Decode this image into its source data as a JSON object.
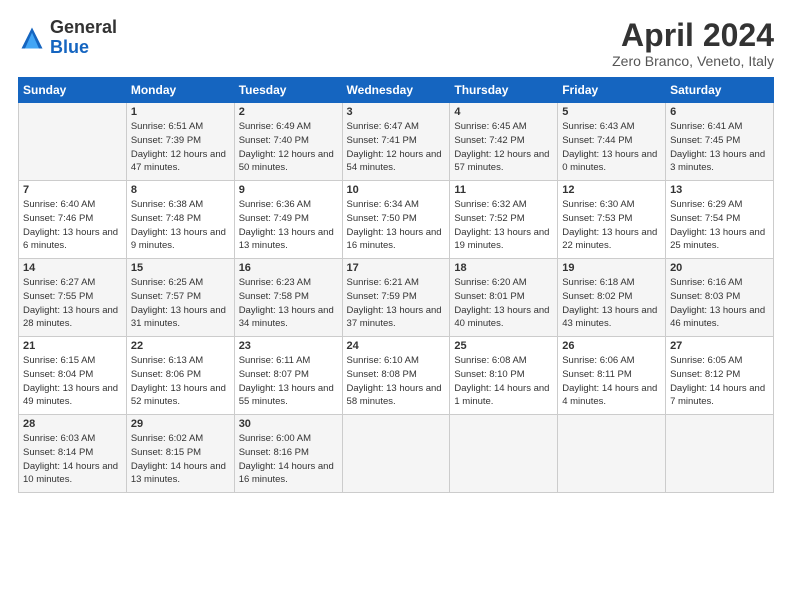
{
  "logo": {
    "general": "General",
    "blue": "Blue"
  },
  "title": "April 2024",
  "location": "Zero Branco, Veneto, Italy",
  "days_of_week": [
    "Sunday",
    "Monday",
    "Tuesday",
    "Wednesday",
    "Thursday",
    "Friday",
    "Saturday"
  ],
  "weeks": [
    [
      {
        "day": "",
        "sunrise": "",
        "sunset": "",
        "daylight": ""
      },
      {
        "day": "1",
        "sunrise": "Sunrise: 6:51 AM",
        "sunset": "Sunset: 7:39 PM",
        "daylight": "Daylight: 12 hours and 47 minutes."
      },
      {
        "day": "2",
        "sunrise": "Sunrise: 6:49 AM",
        "sunset": "Sunset: 7:40 PM",
        "daylight": "Daylight: 12 hours and 50 minutes."
      },
      {
        "day": "3",
        "sunrise": "Sunrise: 6:47 AM",
        "sunset": "Sunset: 7:41 PM",
        "daylight": "Daylight: 12 hours and 54 minutes."
      },
      {
        "day": "4",
        "sunrise": "Sunrise: 6:45 AM",
        "sunset": "Sunset: 7:42 PM",
        "daylight": "Daylight: 12 hours and 57 minutes."
      },
      {
        "day": "5",
        "sunrise": "Sunrise: 6:43 AM",
        "sunset": "Sunset: 7:44 PM",
        "daylight": "Daylight: 13 hours and 0 minutes."
      },
      {
        "day": "6",
        "sunrise": "Sunrise: 6:41 AM",
        "sunset": "Sunset: 7:45 PM",
        "daylight": "Daylight: 13 hours and 3 minutes."
      }
    ],
    [
      {
        "day": "7",
        "sunrise": "Sunrise: 6:40 AM",
        "sunset": "Sunset: 7:46 PM",
        "daylight": "Daylight: 13 hours and 6 minutes."
      },
      {
        "day": "8",
        "sunrise": "Sunrise: 6:38 AM",
        "sunset": "Sunset: 7:48 PM",
        "daylight": "Daylight: 13 hours and 9 minutes."
      },
      {
        "day": "9",
        "sunrise": "Sunrise: 6:36 AM",
        "sunset": "Sunset: 7:49 PM",
        "daylight": "Daylight: 13 hours and 13 minutes."
      },
      {
        "day": "10",
        "sunrise": "Sunrise: 6:34 AM",
        "sunset": "Sunset: 7:50 PM",
        "daylight": "Daylight: 13 hours and 16 minutes."
      },
      {
        "day": "11",
        "sunrise": "Sunrise: 6:32 AM",
        "sunset": "Sunset: 7:52 PM",
        "daylight": "Daylight: 13 hours and 19 minutes."
      },
      {
        "day": "12",
        "sunrise": "Sunrise: 6:30 AM",
        "sunset": "Sunset: 7:53 PM",
        "daylight": "Daylight: 13 hours and 22 minutes."
      },
      {
        "day": "13",
        "sunrise": "Sunrise: 6:29 AM",
        "sunset": "Sunset: 7:54 PM",
        "daylight": "Daylight: 13 hours and 25 minutes."
      }
    ],
    [
      {
        "day": "14",
        "sunrise": "Sunrise: 6:27 AM",
        "sunset": "Sunset: 7:55 PM",
        "daylight": "Daylight: 13 hours and 28 minutes."
      },
      {
        "day": "15",
        "sunrise": "Sunrise: 6:25 AM",
        "sunset": "Sunset: 7:57 PM",
        "daylight": "Daylight: 13 hours and 31 minutes."
      },
      {
        "day": "16",
        "sunrise": "Sunrise: 6:23 AM",
        "sunset": "Sunset: 7:58 PM",
        "daylight": "Daylight: 13 hours and 34 minutes."
      },
      {
        "day": "17",
        "sunrise": "Sunrise: 6:21 AM",
        "sunset": "Sunset: 7:59 PM",
        "daylight": "Daylight: 13 hours and 37 minutes."
      },
      {
        "day": "18",
        "sunrise": "Sunrise: 6:20 AM",
        "sunset": "Sunset: 8:01 PM",
        "daylight": "Daylight: 13 hours and 40 minutes."
      },
      {
        "day": "19",
        "sunrise": "Sunrise: 6:18 AM",
        "sunset": "Sunset: 8:02 PM",
        "daylight": "Daylight: 13 hours and 43 minutes."
      },
      {
        "day": "20",
        "sunrise": "Sunrise: 6:16 AM",
        "sunset": "Sunset: 8:03 PM",
        "daylight": "Daylight: 13 hours and 46 minutes."
      }
    ],
    [
      {
        "day": "21",
        "sunrise": "Sunrise: 6:15 AM",
        "sunset": "Sunset: 8:04 PM",
        "daylight": "Daylight: 13 hours and 49 minutes."
      },
      {
        "day": "22",
        "sunrise": "Sunrise: 6:13 AM",
        "sunset": "Sunset: 8:06 PM",
        "daylight": "Daylight: 13 hours and 52 minutes."
      },
      {
        "day": "23",
        "sunrise": "Sunrise: 6:11 AM",
        "sunset": "Sunset: 8:07 PM",
        "daylight": "Daylight: 13 hours and 55 minutes."
      },
      {
        "day": "24",
        "sunrise": "Sunrise: 6:10 AM",
        "sunset": "Sunset: 8:08 PM",
        "daylight": "Daylight: 13 hours and 58 minutes."
      },
      {
        "day": "25",
        "sunrise": "Sunrise: 6:08 AM",
        "sunset": "Sunset: 8:10 PM",
        "daylight": "Daylight: 14 hours and 1 minute."
      },
      {
        "day": "26",
        "sunrise": "Sunrise: 6:06 AM",
        "sunset": "Sunset: 8:11 PM",
        "daylight": "Daylight: 14 hours and 4 minutes."
      },
      {
        "day": "27",
        "sunrise": "Sunrise: 6:05 AM",
        "sunset": "Sunset: 8:12 PM",
        "daylight": "Daylight: 14 hours and 7 minutes."
      }
    ],
    [
      {
        "day": "28",
        "sunrise": "Sunrise: 6:03 AM",
        "sunset": "Sunset: 8:14 PM",
        "daylight": "Daylight: 14 hours and 10 minutes."
      },
      {
        "day": "29",
        "sunrise": "Sunrise: 6:02 AM",
        "sunset": "Sunset: 8:15 PM",
        "daylight": "Daylight: 14 hours and 13 minutes."
      },
      {
        "day": "30",
        "sunrise": "Sunrise: 6:00 AM",
        "sunset": "Sunset: 8:16 PM",
        "daylight": "Daylight: 14 hours and 16 minutes."
      },
      {
        "day": "",
        "sunrise": "",
        "sunset": "",
        "daylight": ""
      },
      {
        "day": "",
        "sunrise": "",
        "sunset": "",
        "daylight": ""
      },
      {
        "day": "",
        "sunrise": "",
        "sunset": "",
        "daylight": ""
      },
      {
        "day": "",
        "sunrise": "",
        "sunset": "",
        "daylight": ""
      }
    ]
  ]
}
